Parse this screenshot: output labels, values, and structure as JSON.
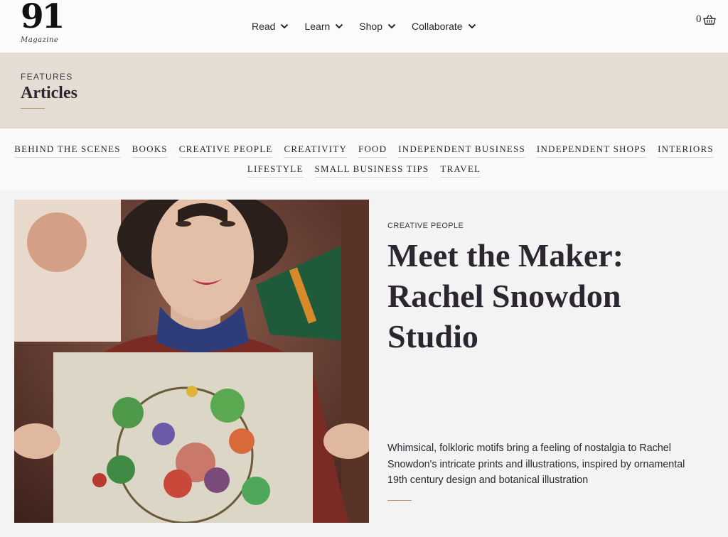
{
  "brand": {
    "logo_number": "91",
    "logo_word": "Magazine"
  },
  "nav": {
    "items": [
      {
        "label": "Read"
      },
      {
        "label": "Learn"
      },
      {
        "label": "Shop"
      },
      {
        "label": "Collaborate"
      }
    ]
  },
  "cart": {
    "count": "0",
    "icon": "basket-icon"
  },
  "section": {
    "kicker": "FEATURES",
    "title": "Articles"
  },
  "categories": {
    "row1": [
      "BEHIND THE SCENES",
      "BOOKS",
      "CREATIVE PEOPLE",
      "CREATIVITY",
      "FOOD",
      "INDEPENDENT BUSINESS",
      "INDEPENDENT SHOPS",
      "INTERIORS"
    ],
    "row2": [
      "LIFESTYLE",
      "SMALL BUSINESS TIPS",
      "TRAVEL"
    ]
  },
  "article": {
    "category": "CREATIVE PEOPLE",
    "title": "Meet the Maker: Rachel Snowdon Studio",
    "excerpt": "Whimsical, folkloric motifs bring a feeling of nostalgia to Rachel Snowdon's intricate prints and illustrations, inspired by ornamental 19th century design and botanical illustration"
  },
  "colors": {
    "band": "#e5ddd4",
    "accent_rule": "#b8926e",
    "text": "#2b2630",
    "page": "#f3f3f3"
  }
}
